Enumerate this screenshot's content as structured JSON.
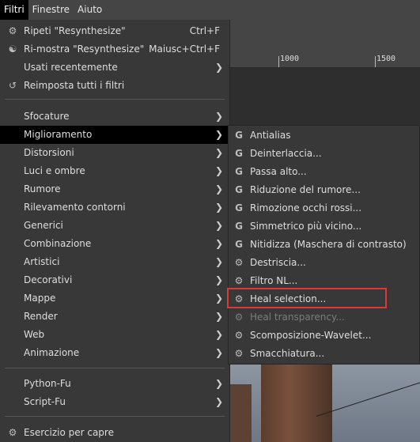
{
  "menubar": {
    "items": [
      {
        "label": "Filtri"
      },
      {
        "label": "Finestre"
      },
      {
        "label": "Aiuto"
      }
    ]
  },
  "ruler": {
    "labels": [
      "1000",
      "1500"
    ]
  },
  "menu": {
    "items": [
      {
        "icon": "gear-icon",
        "label": "Ripeti \"Resynthesize\"",
        "accel": "Ctrl+F"
      },
      {
        "icon": "reshow-icon",
        "label": "Ri-mostra \"Resynthesize\"",
        "accel": "Maiusc+Ctrl+F"
      },
      {
        "label": "Usati recentemente",
        "submenu": true
      },
      {
        "icon": "reset-icon",
        "label": "Reimposta tutti i filtri"
      },
      {
        "label": "Sfocature",
        "submenu": true
      },
      {
        "label": "Miglioramento",
        "submenu": true,
        "selected": true
      },
      {
        "label": "Distorsioni",
        "submenu": true
      },
      {
        "label": "Luci e ombre",
        "submenu": true
      },
      {
        "label": "Rumore",
        "submenu": true
      },
      {
        "label": "Rilevamento contorni",
        "submenu": true
      },
      {
        "label": "Generici",
        "submenu": true
      },
      {
        "label": "Combinazione",
        "submenu": true
      },
      {
        "label": "Artistici",
        "submenu": true
      },
      {
        "label": "Decorativi",
        "submenu": true
      },
      {
        "label": "Mappe",
        "submenu": true
      },
      {
        "label": "Render",
        "submenu": true
      },
      {
        "label": "Web",
        "submenu": true
      },
      {
        "label": "Animazione",
        "submenu": true
      },
      {
        "label": "Python-Fu",
        "submenu": true
      },
      {
        "label": "Script-Fu",
        "submenu": true
      },
      {
        "icon": "gear-icon",
        "label": "Esercizio per capre"
      }
    ]
  },
  "submenu": {
    "items": [
      {
        "icon": "gegl-icon",
        "label": "Antialias"
      },
      {
        "icon": "gegl-icon",
        "label": "Deinterlaccia..."
      },
      {
        "icon": "gegl-icon",
        "label": "Passa alto..."
      },
      {
        "icon": "gegl-icon",
        "label": "Riduzione del rumore..."
      },
      {
        "icon": "gegl-icon",
        "label": "Rimozione occhi rossi..."
      },
      {
        "icon": "gegl-icon",
        "label": "Simmetrico più vicino..."
      },
      {
        "icon": "gegl-icon",
        "label": "Nitidizza (Maschera di contrasto)"
      },
      {
        "icon": "gear-icon",
        "label": "Destriscia..."
      },
      {
        "icon": "gear-icon",
        "label": "Filtro NL..."
      },
      {
        "icon": "gear-icon",
        "label": "Heal selection...",
        "highlighted": true
      },
      {
        "icon": "gear-icon",
        "label": "Heal transparency...",
        "disabled": true
      },
      {
        "icon": "gear-icon",
        "label": "Scomposizione-Wavelet..."
      },
      {
        "icon": "gear-icon",
        "label": "Smacchiatura..."
      }
    ]
  },
  "colors": {
    "highlight_box": "#d83b30",
    "menu_bg": "#383838",
    "selected_bg": "#000000"
  }
}
